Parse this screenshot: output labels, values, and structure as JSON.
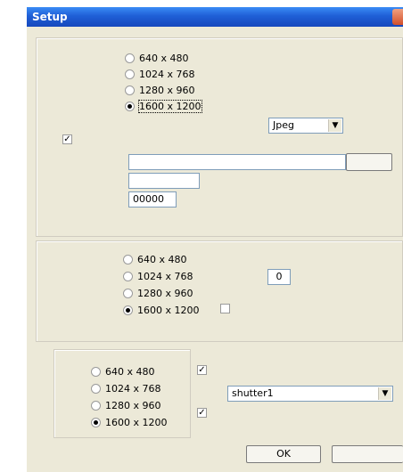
{
  "window": {
    "title": "Setup"
  },
  "panel1": {
    "resolutions": [
      "640 x 480",
      "1024 x 768",
      "1280 x 960",
      "1600 x 1200"
    ],
    "selected": "1600 x 1200",
    "format": "Jpeg",
    "format_arrow": "▼",
    "checkbox_checked": true,
    "checkmark": "✓",
    "path_value": "",
    "prefix_value": "",
    "counter_value": "00000"
  },
  "panel2": {
    "resolutions": [
      "640 x 480",
      "1024 x 768",
      "1280 x 960",
      "1600 x 1200"
    ],
    "selected": "1600 x 1200",
    "number_value": "0",
    "checkbox_checked": false
  },
  "panel3": {
    "resolutions": [
      "640 x 480",
      "1024 x 768",
      "1280 x 960",
      "1600 x 1200"
    ],
    "selected": "1600 x 1200",
    "checkbox1_checked": true,
    "checkbox2_checked": true,
    "checkmark": "✓",
    "shutter": "shutter1",
    "shutter_arrow": "▼"
  },
  "buttons": {
    "ok": "OK",
    "cancel": ""
  }
}
